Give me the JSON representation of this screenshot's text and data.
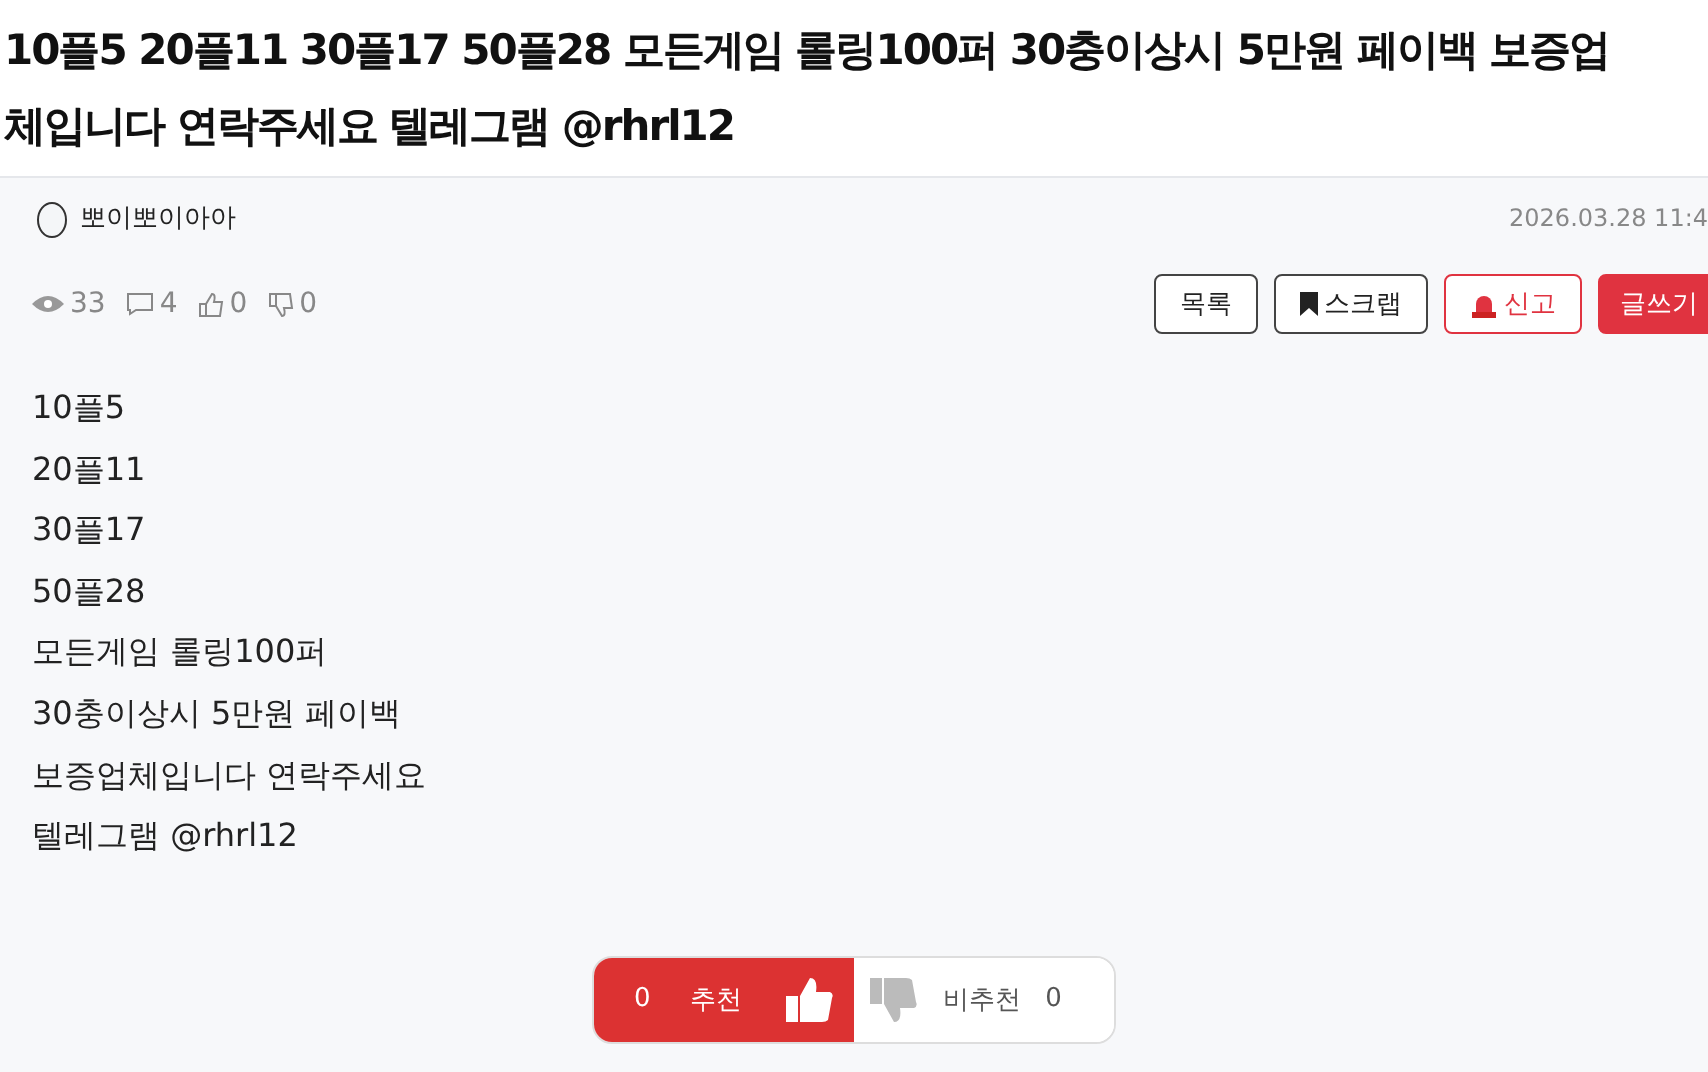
{
  "title_lines": [
    "10플5 20플11 30플17 50플28 모든게임 롤링100퍼 30충이상시 5만원 페이백 보증업",
    "체입니다 연락주세요 텔레그램 @rhrl12"
  ],
  "author": "뽀이뽀이아아",
  "date": "2026.03.28 11:4",
  "stats": [
    {
      "kind": "views",
      "value": "33"
    },
    {
      "kind": "comments",
      "value": "4"
    },
    {
      "kind": "likes",
      "value": "0"
    },
    {
      "kind": "dislikes",
      "value": "0"
    }
  ],
  "buttons": [
    {
      "kind": "list",
      "label": "목록"
    },
    {
      "kind": "scrap",
      "label": "스크랩"
    },
    {
      "kind": "report",
      "label": "신고"
    },
    {
      "kind": "write",
      "label": "글쓰기"
    }
  ],
  "body": [
    "10플5",
    "20플11",
    "30플17",
    "50플28",
    "모든게임 롤링100퍼",
    "30충이상시 5만원 페이백",
    "보증업체입니다 연락주세요",
    "텔레그램 @rhrl12"
  ],
  "vote": {
    "up_count": "0",
    "up_label": "추천",
    "down_label": "비추천",
    "down_count": "0"
  }
}
